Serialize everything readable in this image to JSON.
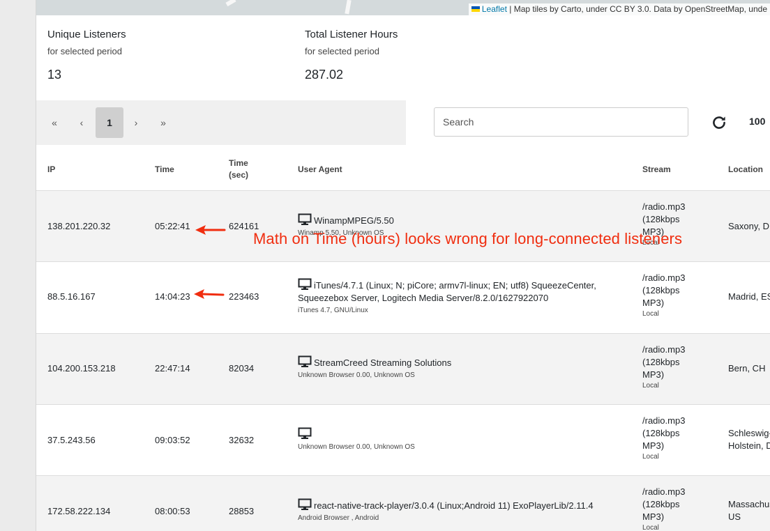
{
  "map": {
    "attribution_link": "Leaflet",
    "attribution_text": " | Map tiles by Carto, under CC BY 3.0. Data by OpenStreetMap, unde"
  },
  "stats": {
    "unique": {
      "title": "Unique Listeners",
      "sub": "for selected period",
      "value": "13"
    },
    "hours": {
      "title": "Total Listener Hours",
      "sub": "for selected period",
      "value": "287.02"
    }
  },
  "pager": {
    "first": "«",
    "prev": "‹",
    "current": "1",
    "next": "›",
    "last": "»"
  },
  "search": {
    "placeholder": "Search"
  },
  "per_page": "100",
  "columns": {
    "ip": "IP",
    "time": "Time",
    "time_sec_1": "Time",
    "time_sec_2": "(sec)",
    "ua": "User Agent",
    "stream": "Stream",
    "location": "Location"
  },
  "rows": [
    {
      "ip": "138.201.220.32",
      "time": "05:22:41",
      "sec": "624161",
      "ua": "WinampMPEG/5.50",
      "ua_sub": "Winamp 5.50, Unknown OS",
      "stream_1": "/radio.mp3",
      "stream_2": "(128kbps",
      "stream_3": "MP3)",
      "stream_local": "Local",
      "loc_1": "Saxony, DE",
      "loc_2": ""
    },
    {
      "ip": "88.5.16.167",
      "time": "14:04:23",
      "sec": "223463",
      "ua": "iTunes/4.7.1 (Linux; N; piCore; armv7l-linux; EN; utf8) SqueezeCenter,",
      "ua_2": "Squeezebox Server, Logitech Media Server/8.2.0/1627922070",
      "ua_sub": "iTunes 4.7, GNU/Linux",
      "stream_1": "/radio.mp3",
      "stream_2": "(128kbps",
      "stream_3": "MP3)",
      "stream_local": "Local",
      "loc_1": "Madrid, ES",
      "loc_2": ""
    },
    {
      "ip": "104.200.153.218",
      "time": "22:47:14",
      "sec": "82034",
      "ua": "StreamCreed Streaming Solutions",
      "ua_sub": "Unknown Browser 0.00, Unknown OS",
      "stream_1": "/radio.mp3",
      "stream_2": "(128kbps",
      "stream_3": "MP3)",
      "stream_local": "Local",
      "loc_1": "Bern, CH",
      "loc_2": ""
    },
    {
      "ip": "37.5.243.56",
      "time": "09:03:52",
      "sec": "32632",
      "ua": "",
      "ua_sub": "Unknown Browser 0.00, Unknown OS",
      "stream_1": "/radio.mp3",
      "stream_2": "(128kbps",
      "stream_3": "MP3)",
      "stream_local": "Local",
      "loc_1": "Schleswig-",
      "loc_2": "Holstein, DE"
    },
    {
      "ip": "172.58.222.134",
      "time": "08:00:53",
      "sec": "28853",
      "ua": "react-native-track-player/3.0.4 (Linux;Android 11) ExoPlayerLib/2.11.4",
      "ua_sub": "Android Browser , Android",
      "stream_1": "/radio.mp3",
      "stream_2": "(128kbps",
      "stream_3": "MP3)",
      "stream_local": "Local",
      "loc_1": "Massachusetts,",
      "loc_2": "US"
    }
  ],
  "annotation": {
    "text": "Math on Time (hours) looks wrong for long-connected listeners",
    "color": "#f02d0f"
  }
}
